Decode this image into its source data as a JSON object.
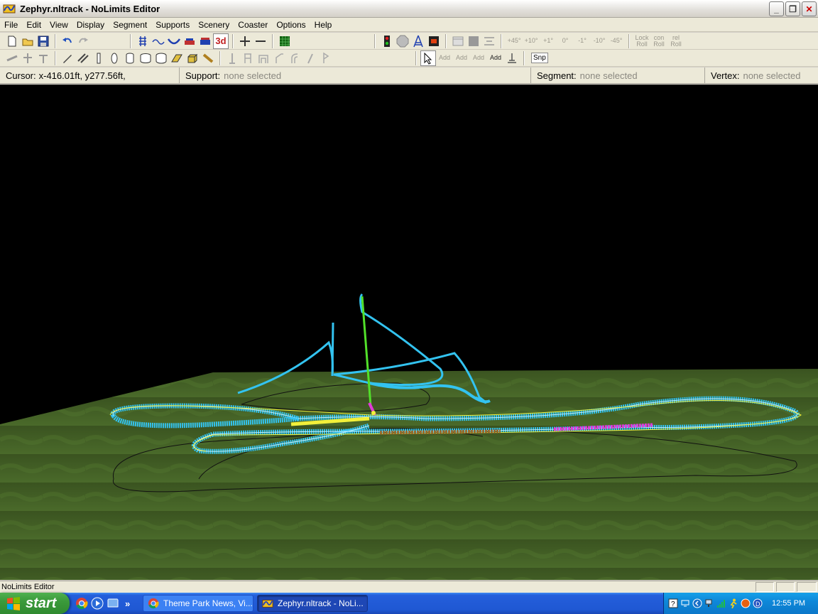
{
  "window": {
    "title": "Zephyr.nltrack - NoLimits Editor",
    "buttons": {
      "minimize": "_",
      "restore": "❐",
      "close": "✕"
    }
  },
  "menu": [
    "File",
    "Edit",
    "View",
    "Display",
    "Segment",
    "Supports",
    "Scenery",
    "Coaster",
    "Options",
    "Help"
  ],
  "toolbar": {
    "three_d_label": "3d",
    "angle_buttons": [
      "+45°",
      "+10°",
      "+1°",
      "0°",
      "-1°",
      "-10°",
      "-45°"
    ],
    "roll_buttons": [
      [
        "Lock",
        "Roll"
      ],
      [
        "con",
        "Roll"
      ],
      [
        "rel",
        "Roll"
      ]
    ],
    "add_buttons": [
      [
        "Add"
      ],
      [
        "Add"
      ],
      [
        "Add"
      ],
      [
        "Add"
      ]
    ],
    "snap_label": "Snp"
  },
  "info": {
    "cursor_label": "Cursor:",
    "cursor_value": "x-416.01ft, y277.56ft,",
    "support_label": "Support:",
    "support_value": "none selected",
    "segment_label": "Segment:",
    "segment_value": "none selected",
    "vertex_label": "Vertex:",
    "vertex_value": "none selected"
  },
  "status": {
    "text": "NoLimits Editor"
  },
  "taskbar": {
    "start": "start",
    "more": "»",
    "tasks": [
      {
        "label": "Theme Park News, Vi..."
      },
      {
        "label": "Zephyr.nltrack - NoLi..."
      }
    ],
    "clock": "12:55 PM"
  },
  "colors": {
    "track": "#33c3f0",
    "ground": "#3f5a22",
    "highlight_magenta": "#e23ad8",
    "highlight_yellow": "#f2f03a",
    "lift_green": "#52e02a",
    "brake_brown": "#9a6a2a"
  }
}
